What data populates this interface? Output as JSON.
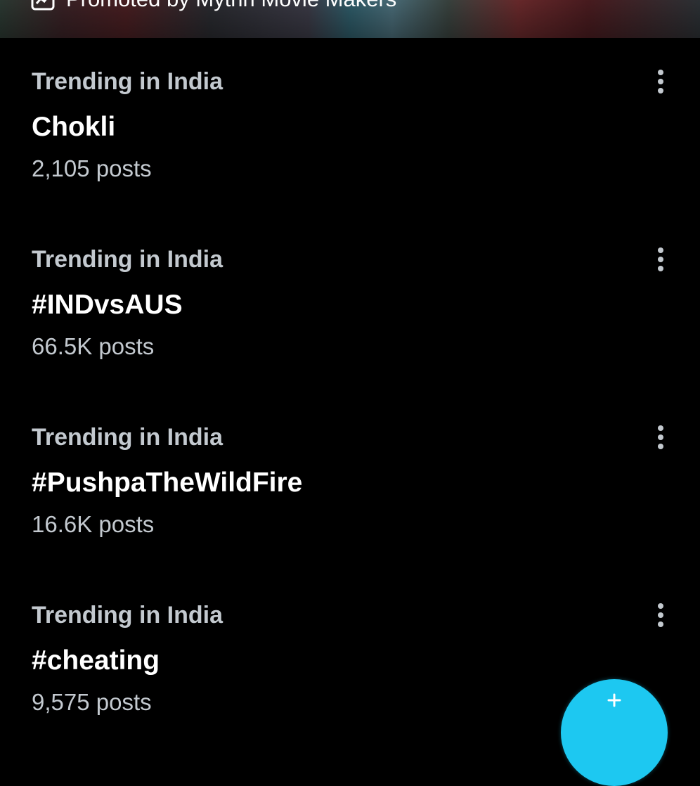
{
  "promo": {
    "text": "Promoted by Mythri Movie Makers",
    "icon": "promoted-icon"
  },
  "trends": [
    {
      "context": "Trending in India",
      "name": "Chokli",
      "posts": "2,105 posts"
    },
    {
      "context": "Trending in India",
      "name": "#INDvsAUS",
      "posts": "66.5K posts"
    },
    {
      "context": "Trending in India",
      "name": "#PushpaTheWildFire",
      "posts": "16.6K posts"
    },
    {
      "context": "Trending in India",
      "name": "#cheating",
      "posts": "9,575 posts"
    }
  ],
  "fab": {
    "icon": "compose-plus-icon",
    "color": "#1dc8f1"
  },
  "colors": {
    "background": "#000000",
    "primary_text": "#ffffff",
    "secondary_text": "#c3c9cf"
  }
}
